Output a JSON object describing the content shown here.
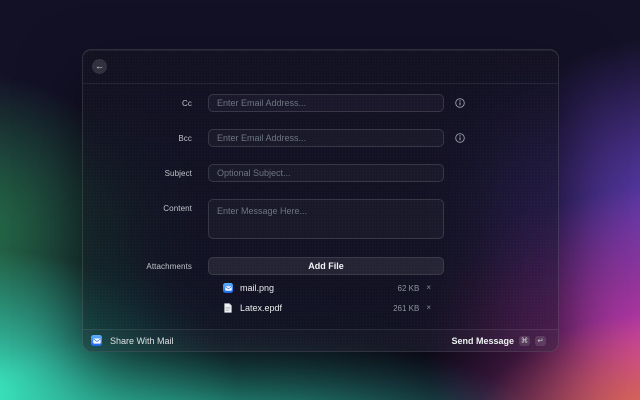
{
  "window": {
    "header": {
      "back_icon_glyph": "←"
    },
    "form": {
      "cc": {
        "label": "Cc",
        "placeholder": "Enter Email Address..."
      },
      "bcc": {
        "label": "Bcc",
        "placeholder": "Enter Email Address..."
      },
      "subject": {
        "label": "Subject",
        "placeholder": "Optional Subject..."
      },
      "content": {
        "label": "Content",
        "placeholder": "Enter Message Here..."
      },
      "attachments": {
        "label": "Attachments",
        "add_button_label": "Add File",
        "files": [
          {
            "name": "mail.png",
            "size": "62 KB",
            "icon": "mail-app-icon",
            "remove_glyph": "×"
          },
          {
            "name": "Latex.epdf",
            "size": "261 KB",
            "icon": "document-icon",
            "remove_glyph": "×"
          }
        ]
      }
    },
    "footer": {
      "app_icon": "mail-app-icon",
      "app_name": "Share With Mail",
      "primary_action_label": "Send Message",
      "shortcut_keys": [
        "⌘",
        "↵"
      ]
    }
  },
  "icons": {
    "back": "arrow-left-icon",
    "info": "info-icon",
    "remove": "close-icon",
    "command_key": "⌘",
    "return_key": "↵"
  },
  "colors": {
    "base_bg": "#131126",
    "teal": "#3efac9",
    "green": "#2c9658",
    "purple": "#6e46d2",
    "magenta": "#e03ec0",
    "orange": "#ec7648",
    "mail_blue": "#1a66e8"
  }
}
